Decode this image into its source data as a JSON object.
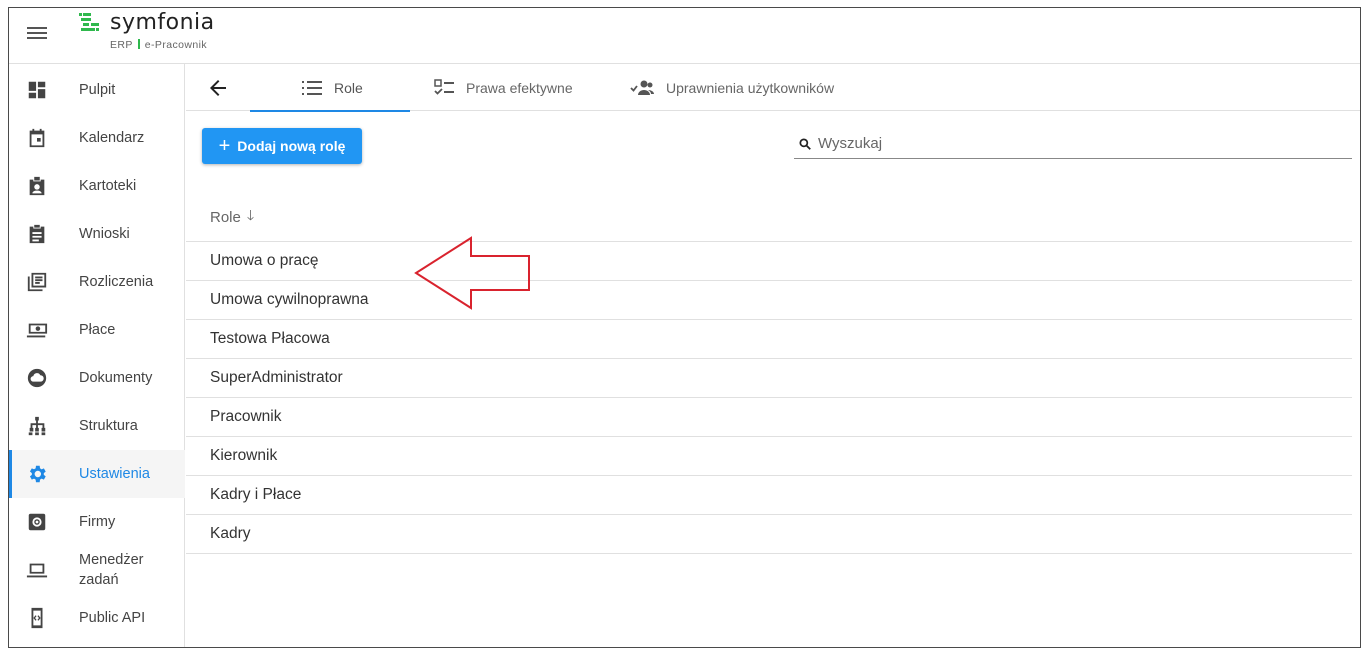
{
  "header": {
    "brand": "symfonia",
    "sub_erp": "ERP",
    "sub_module": "e-Pracownik"
  },
  "sidebar": {
    "items": [
      {
        "label": "Pulpit",
        "icon": "dashboard-icon"
      },
      {
        "label": "Kalendarz",
        "icon": "calendar-icon"
      },
      {
        "label": "Kartoteki",
        "icon": "badge-icon"
      },
      {
        "label": "Wnioski",
        "icon": "clipboard-icon"
      },
      {
        "label": "Rozliczenia",
        "icon": "list-document-icon"
      },
      {
        "label": "Płace",
        "icon": "money-icon"
      },
      {
        "label": "Dokumenty",
        "icon": "cloud-icon"
      },
      {
        "label": "Struktura",
        "icon": "org-structure-icon"
      },
      {
        "label": "Ustawienia",
        "icon": "gear-icon",
        "active": true
      },
      {
        "label": "Firmy",
        "icon": "settings-box-icon"
      },
      {
        "label": "Menedżer zadań",
        "icon": "laptop-icon"
      },
      {
        "label": "Public API",
        "icon": "api-icon"
      }
    ]
  },
  "tabs": [
    {
      "label": "Role",
      "icon": "list-icon",
      "active": true
    },
    {
      "label": "Prawa efektywne",
      "icon": "checklist-icon"
    },
    {
      "label": "Uprawnienia użytkowników",
      "icon": "users-check-icon"
    }
  ],
  "toolbar": {
    "add_label": "Dodaj nową rolę",
    "search_placeholder": "Wyszukaj"
  },
  "table": {
    "header": "Role",
    "sort": "desc",
    "rows": [
      "Umowa o pracę",
      "Umowa cywilnoprawna",
      "Testowa Płacowa",
      "SuperAdministrator",
      "Pracownik",
      "Kierownik",
      "Kadry i Płace",
      "Kadry"
    ]
  },
  "colors": {
    "accent": "#1e88e5",
    "button": "#2196f3",
    "brand_green": "#2fb84d",
    "annotation": "#d9232e"
  }
}
